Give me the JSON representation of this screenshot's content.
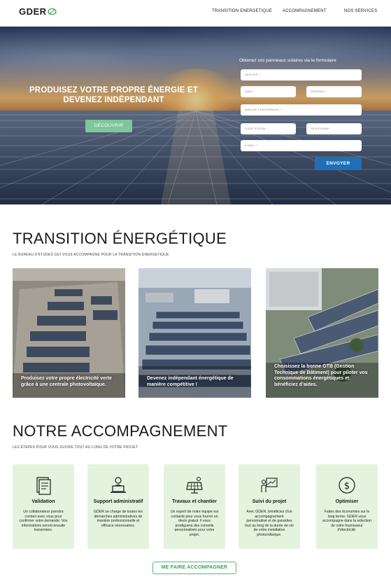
{
  "header": {
    "logo": "GDER",
    "nav": [
      "TRANSITION ENERGETIQUE",
      "ACCOMPAGNEMENT",
      "NOS SERVICES"
    ]
  },
  "hero": {
    "title": "PRODUISEZ VOTRE PROPRE ÉNERGIE ET DEVENEZ INDÉPENDANT",
    "discover_label": "DÉCOUVRIR",
    "form": {
      "title": "Obtenez vos panneaux solaires via le formulaire",
      "service": "SERVICE *",
      "nom": "NOM *",
      "prenom": "PRÉNOM *",
      "entreprise": "NOM DE L'ENTREPRISE *",
      "code_postal": "CODE POSTAL *",
      "telephone": "TELEPHONE*",
      "email": "E-MAIL *",
      "submit_label": "ENVOYER"
    }
  },
  "transition": {
    "title": "TRANSITION ÉNERGÉTIQUE",
    "subtitle": "LE BUREAU D'ÉTUDES QUI VOUS ACCOMPAGNE POUR LA TRANSITION ÉNERGETIQUE",
    "cards": [
      {
        "caption": "Produisez votre propre électricité verte grâce à une centrale photovoltaïque."
      },
      {
        "caption": "Devenez indépendant énergétique de manière compétitive !"
      },
      {
        "caption": "Choisissez la bonne GTB (Gestion Technique de Bâtiment) pour piloter vos consommations énergétiques et bénéficiez d'aides."
      }
    ]
  },
  "accompagnement": {
    "title": "NOTRE ACCOMPAGNEMENT",
    "subtitle": "LES ÉTAPES POUR VOUS SUIVRE TOUT AU LONG DE VOTRE PROJET",
    "steps": [
      {
        "icon": "document-icon",
        "title": "Validation",
        "text": "Un collaborateur prendra contact avec vous pour confirmer votre demande. Vos informations seront ensuite transmises."
      },
      {
        "icon": "laptop-user-icon",
        "title": "Support administratif",
        "text": "GDER se charge de toutes les démarches administratives de manière professionnelle et efficace nécessaires."
      },
      {
        "icon": "solar-panel-icon",
        "title": "Travaux et chantier",
        "text": "Un expert de notre équipe est contacté pour vous fournir un devis gratuit. Il vous prodiguera des conseils personnalisés pour votre projet."
      },
      {
        "icon": "presentation-chart-icon",
        "title": "Suivi du projet",
        "text": "Avec GDER, bénéficiez d'un accompagnement personnalisé et de garanties tout au long de la durée de vie de votre installation photovoltaïque."
      },
      {
        "icon": "dollar-coin-icon",
        "title": "Optimiser",
        "text": "Faites des économies sur le long terme. GDER vous accompagne dans la sélection de votre fournisseur d'électricité."
      }
    ],
    "cta_label": "ME FAIRE ACCOMPAGNER"
  },
  "colors": {
    "green_button": "#7ec79a",
    "blue_button": "#1f6fb6",
    "card_bg": "#e3f3dd",
    "outline_green": "#5cb870"
  }
}
